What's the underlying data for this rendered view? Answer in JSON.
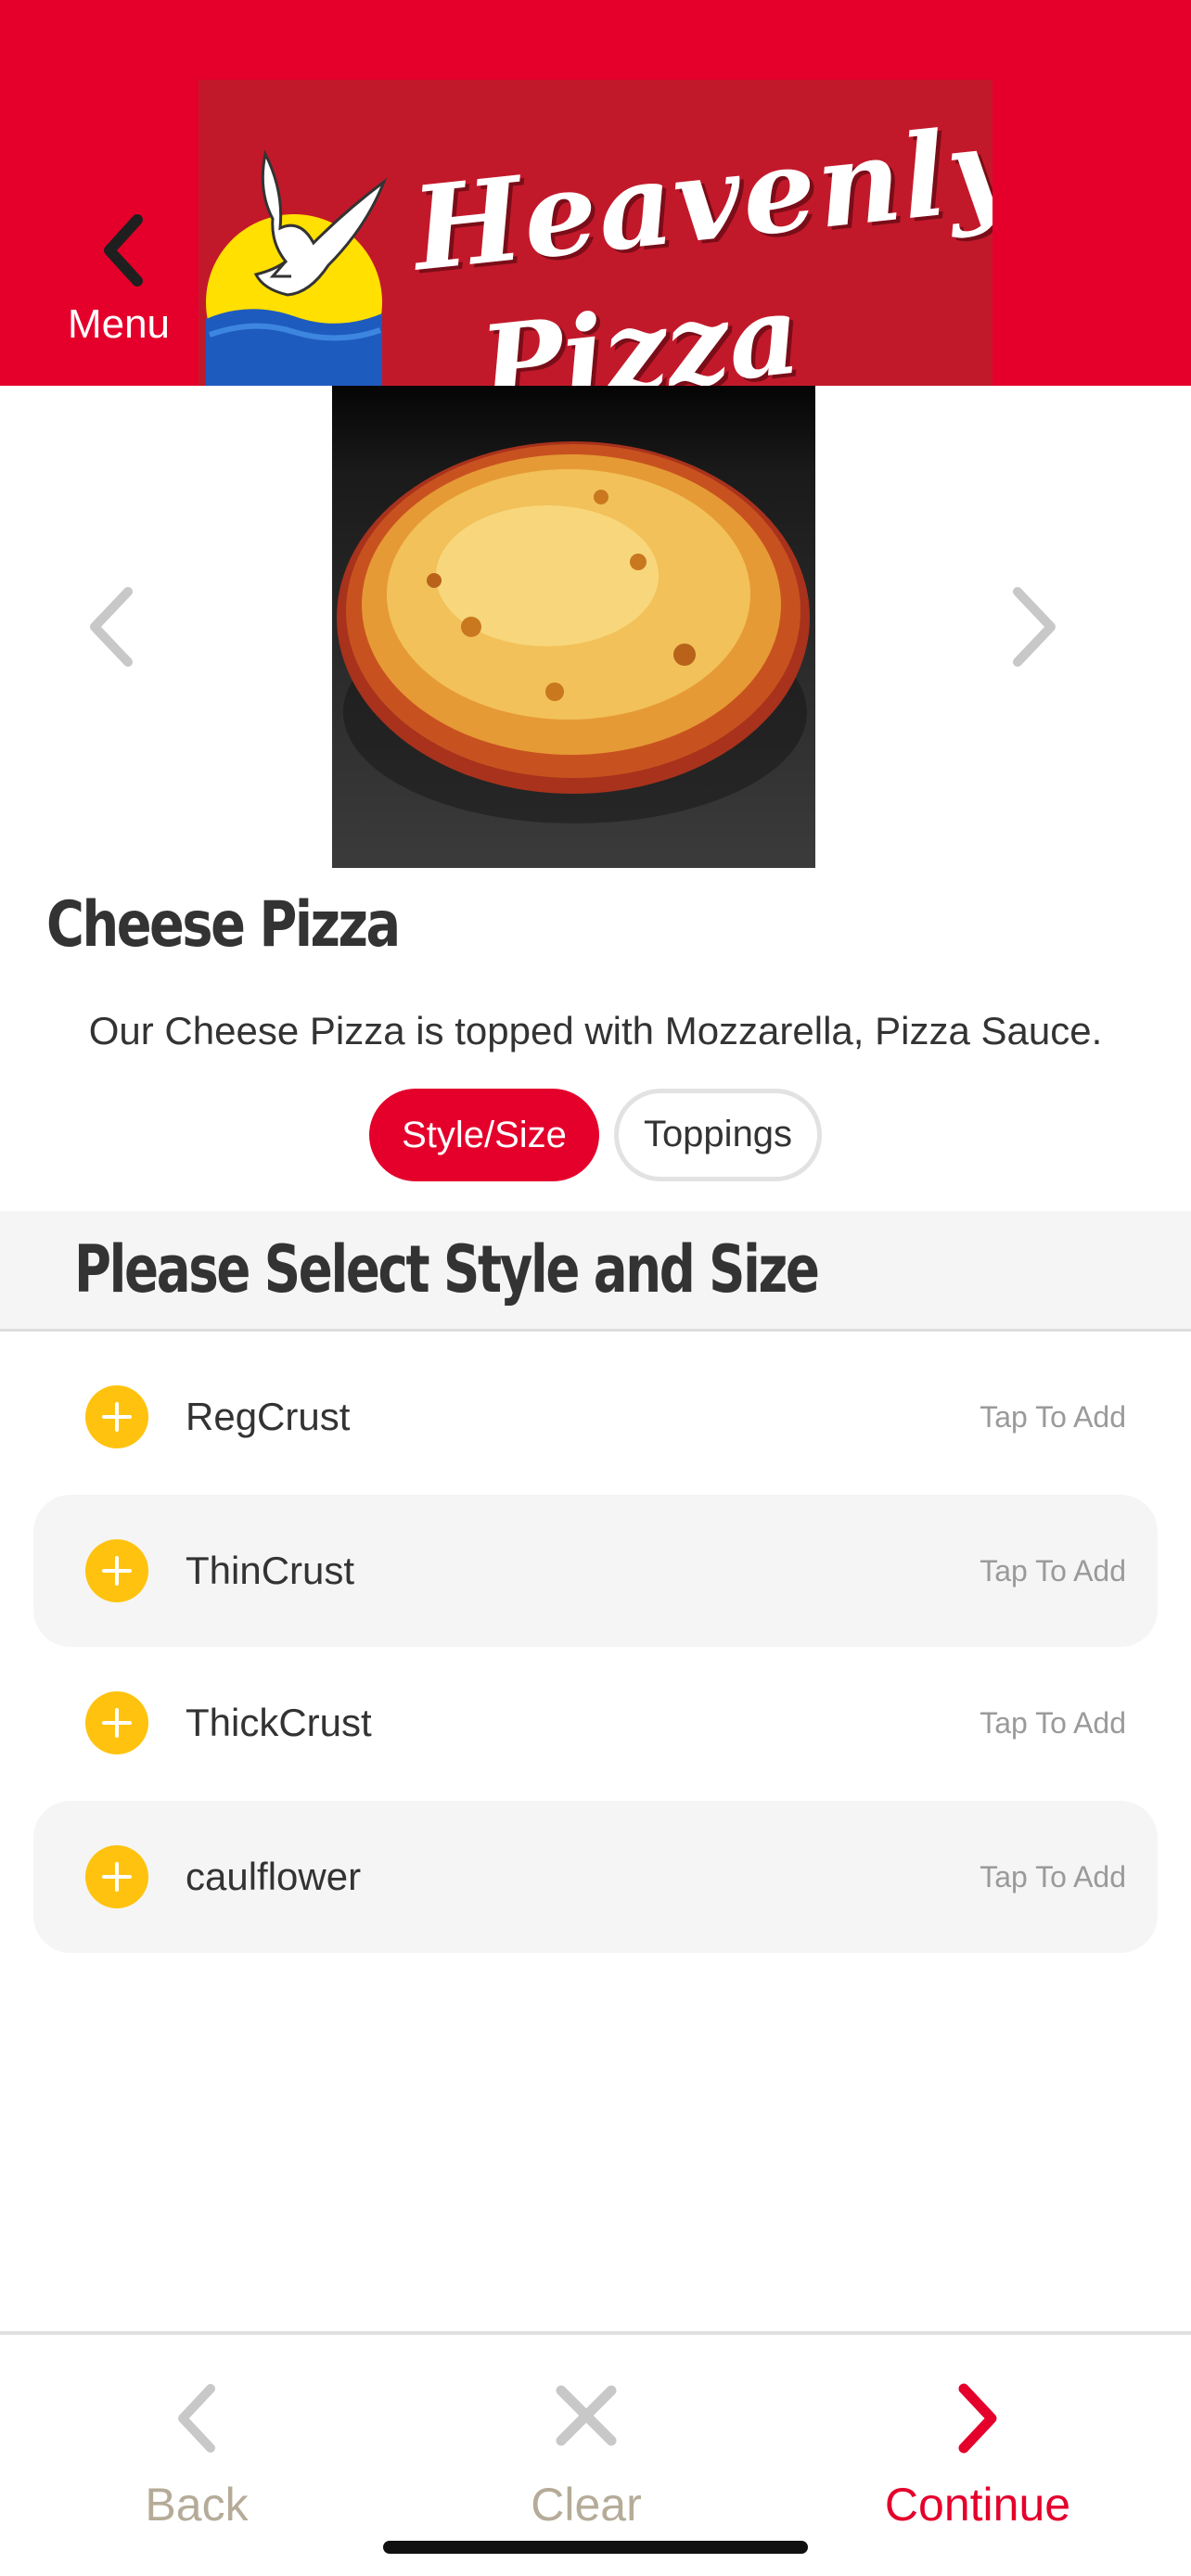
{
  "header": {
    "menu_label": "Menu",
    "logo": {
      "brand_line1": "Heavenly",
      "brand_line2": "Pizza"
    }
  },
  "product": {
    "title": "Cheese Pizza",
    "description": "Our Cheese Pizza is topped with Mozzarella, Pizza Sauce."
  },
  "tabs": [
    {
      "label": "Style/Size",
      "active": true
    },
    {
      "label": "Toppings",
      "active": false
    }
  ],
  "section": {
    "title": "Please Select Style and Size"
  },
  "options": [
    {
      "label": "RegCrust",
      "hint": "Tap To Add"
    },
    {
      "label": "ThinCrust",
      "hint": "Tap To Add"
    },
    {
      "label": "ThickCrust",
      "hint": "Tap To Add"
    },
    {
      "label": "caulflower",
      "hint": "Tap To Add"
    }
  ],
  "bottom_bar": {
    "back_label": "Back",
    "clear_label": "Clear",
    "continue_label": "Continue"
  },
  "colors": {
    "brand_red": "#e4002b",
    "logo_red": "#c2192a",
    "accent_yellow": "#ffc20e",
    "muted_beige": "#b5ab98",
    "muted_gray": "#c8c8c8"
  },
  "icons": {
    "menu_back": "chevron-left-icon",
    "carousel_prev": "chevron-left-icon",
    "carousel_next": "chevron-right-icon",
    "option_add": "plus-circle-icon",
    "back": "chevron-left-icon",
    "clear": "x-icon",
    "continue": "chevron-right-icon"
  }
}
